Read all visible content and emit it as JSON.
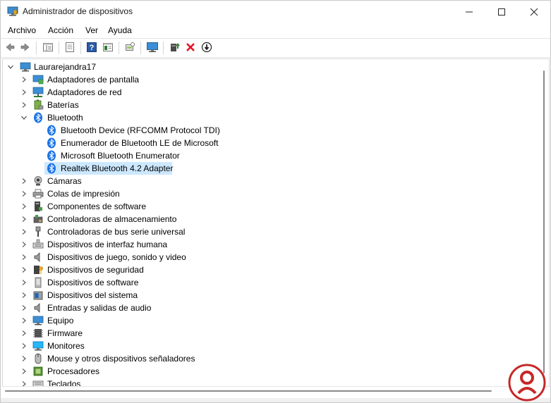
{
  "window": {
    "title": "Administrador de dispositivos",
    "controls": [
      "minimize-icon",
      "maximize-icon",
      "close-icon"
    ]
  },
  "menu": {
    "items": [
      "Archivo",
      "Acción",
      "Ver",
      "Ayuda"
    ]
  },
  "toolbar": {
    "icons": [
      "back-arrow-icon",
      "forward-arrow-icon",
      "show-hide-tree-icon",
      "properties-icon",
      "help-icon",
      "view-icon",
      "scan-hardware-icon",
      "monitor-icon",
      "update-driver-icon",
      "uninstall-icon",
      "disable-device-icon"
    ]
  },
  "tree": {
    "root": "Laurarejandra17",
    "items": [
      {
        "label": "Adaptadores de pantalla",
        "icon": "display-adapter-icon",
        "expanded": false
      },
      {
        "label": "Adaptadores de red",
        "icon": "network-adapter-icon",
        "expanded": false
      },
      {
        "label": "Baterías",
        "icon": "battery-icon",
        "expanded": false
      },
      {
        "label": "Bluetooth",
        "icon": "bluetooth-icon",
        "expanded": true,
        "children": [
          {
            "label": "Bluetooth Device (RFCOMM Protocol TDI)",
            "icon": "bluetooth-icon"
          },
          {
            "label": "Enumerador de Bluetooth LE de Microsoft",
            "icon": "bluetooth-icon"
          },
          {
            "label": "Microsoft Bluetooth Enumerator",
            "icon": "bluetooth-icon"
          },
          {
            "label": "Realtek Bluetooth 4.2 Adapter",
            "icon": "bluetooth-icon",
            "selected": true
          }
        ]
      },
      {
        "label": "Cámaras",
        "icon": "camera-icon",
        "expanded": false
      },
      {
        "label": "Colas de impresión",
        "icon": "printer-icon",
        "expanded": false
      },
      {
        "label": "Componentes de software",
        "icon": "software-component-icon",
        "expanded": false
      },
      {
        "label": "Controladoras de almacenamiento",
        "icon": "storage-controller-icon",
        "expanded": false
      },
      {
        "label": "Controladoras de bus serie universal",
        "icon": "usb-icon",
        "expanded": false
      },
      {
        "label": "Dispositivos de interfaz humana",
        "icon": "hid-icon",
        "expanded": false
      },
      {
        "label": "Dispositivos de juego, sonido y video",
        "icon": "speaker-icon",
        "expanded": false
      },
      {
        "label": "Dispositivos de seguridad",
        "icon": "security-key-icon",
        "expanded": false
      },
      {
        "label": "Dispositivos de software",
        "icon": "software-device-icon",
        "expanded": false
      },
      {
        "label": "Dispositivos del sistema",
        "icon": "system-device-icon",
        "expanded": false
      },
      {
        "label": "Entradas y salidas de audio",
        "icon": "audio-io-icon",
        "expanded": false
      },
      {
        "label": "Equipo",
        "icon": "computer-icon",
        "expanded": false
      },
      {
        "label": "Firmware",
        "icon": "firmware-icon",
        "expanded": false
      },
      {
        "label": "Monitores",
        "icon": "monitor-icon",
        "expanded": false
      },
      {
        "label": "Mouse y otros dispositivos señaladores",
        "icon": "mouse-icon",
        "expanded": false
      },
      {
        "label": "Procesadores",
        "icon": "processor-icon",
        "expanded": false
      },
      {
        "label": "Teclados",
        "icon": "keyboard-icon",
        "expanded": false
      }
    ]
  },
  "colors": {
    "selection": "#cce8ff",
    "bluetooth": "#1a73e8",
    "uninstall_red": "#e81123"
  }
}
